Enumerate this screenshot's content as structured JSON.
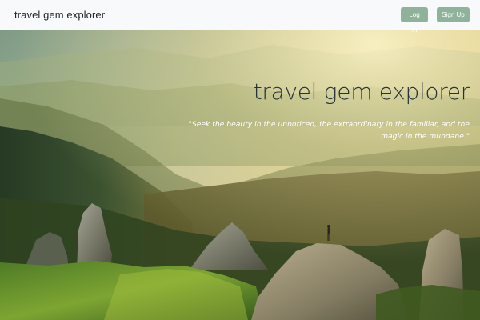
{
  "navbar": {
    "brand": "travel gem explorer",
    "login_label": "Log In",
    "signup_label": "Sign Up",
    "button_color": "#8fb39a",
    "background_color": "#f8f9fa"
  },
  "hero": {
    "title": "travel gem explorer",
    "quote": "\"Seek the beauty in the unnoticed, the extraordinary in the familiar, and the magic in the mundane.\"",
    "title_color": "#263238",
    "quote_color": "#ffffff"
  }
}
